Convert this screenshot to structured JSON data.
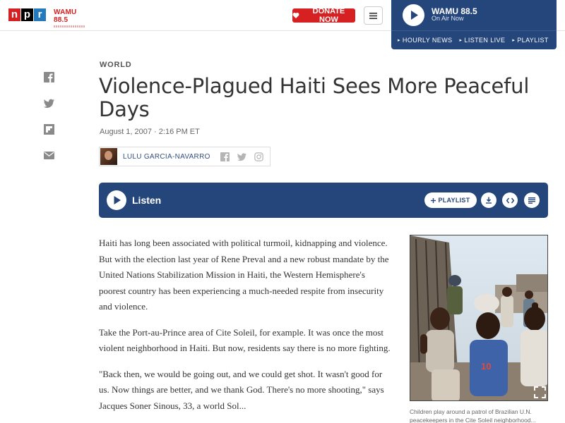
{
  "header": {
    "logo_letters": [
      "n",
      "p",
      "r"
    ],
    "station_logo": "WAMU 88.5",
    "donate_label": "DONATE NOW",
    "menu_icon": "hamburger-icon"
  },
  "on_air": {
    "station": "WAMU 88.5",
    "status": "On Air Now",
    "links": [
      "HOURLY NEWS",
      "LISTEN LIVE",
      "PLAYLIST"
    ]
  },
  "share": {
    "icons": [
      "facebook-icon",
      "twitter-icon",
      "flipboard-icon",
      "email-icon"
    ]
  },
  "article": {
    "slug": "WORLD",
    "title": "Violence-Plagued Haiti Sees More Peaceful Days",
    "dateline": "August 1, 2007 · 2:16 PM ET",
    "author": "LULU GARCIA-NAVARRO",
    "listen_label": "Listen",
    "playlist_label": "PLAYLIST",
    "paragraphs": [
      "Haiti has long been associated with political turmoil, kidnapping and violence. But with the election last year of Rene Preval and a new robust mandate by the United Nations Stabilization Mission in Haiti, the Western Hemisphere's poorest country has been experiencing a much-needed respite from insecurity and violence.",
      "Take the Port-au-Prince area of Cite Soleil, for example. It was once the most violent neighborhood in Haiti. But now, residents say there is no more fighting.",
      "\"Back then, we would be going out, and we could get shot. It wasn't good for us. Now things are better, and we thank God. There's no more shooting,\" says Jacques Soner Sinous, 33, a world Sol..."
    ],
    "photo_caption": "Children play around a patrol of Brazilian U.N. peacekeepers in the Cite Soleil neighborhood..."
  },
  "colors": {
    "npr_red": "#d62021",
    "npr_blue": "#237bbd",
    "player_blue": "#25467b",
    "icon_gray": "#888888"
  }
}
